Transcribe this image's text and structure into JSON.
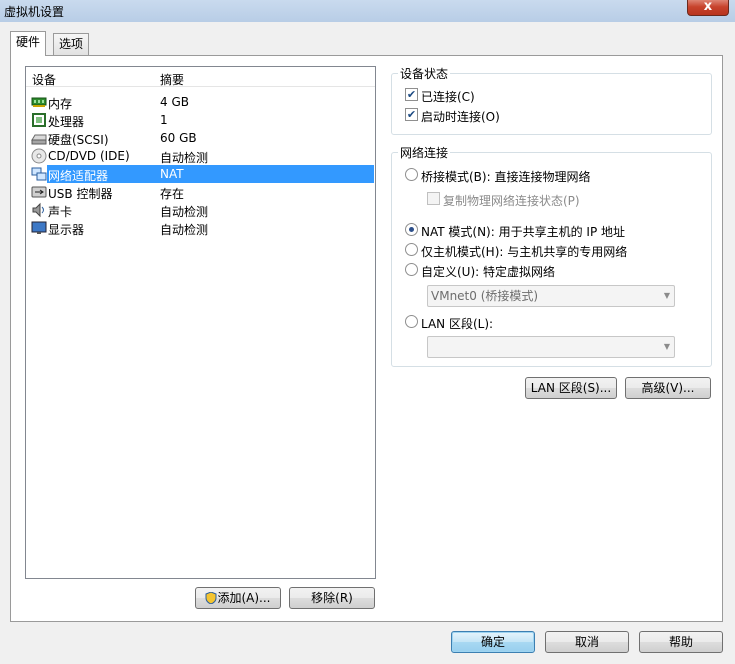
{
  "window": {
    "title": "虚拟机设置",
    "close_label": "x"
  },
  "tabs": [
    {
      "label": "硬件",
      "active": true
    },
    {
      "label": "选项",
      "active": false
    }
  ],
  "device_list": {
    "col_device": "设备",
    "col_summary": "摘要",
    "items": [
      {
        "name": "内存",
        "summary": "4 GB",
        "icon": "memory-icon"
      },
      {
        "name": "处理器",
        "summary": "1",
        "icon": "processor-icon"
      },
      {
        "name": "硬盘(SCSI)",
        "summary": "60 GB",
        "icon": "harddisk-icon"
      },
      {
        "name": "CD/DVD (IDE)",
        "summary": "自动检测",
        "icon": "cd-dvd-icon"
      },
      {
        "name": "网络适配器",
        "summary": "NAT",
        "icon": "network-adapter-icon",
        "selected": true
      },
      {
        "name": "USB 控制器",
        "summary": "存在",
        "icon": "usb-icon"
      },
      {
        "name": "声卡",
        "summary": "自动检测",
        "icon": "sound-card-icon"
      },
      {
        "name": "显示器",
        "summary": "自动检测",
        "icon": "display-icon"
      }
    ]
  },
  "buttons": {
    "add": "添加(A)...",
    "remove": "移除(R)",
    "lan_segment": "LAN 区段(S)...",
    "advanced": "高级(V)...",
    "ok": "确定",
    "cancel": "取消",
    "help": "帮助"
  },
  "device_status": {
    "title": "设备状态",
    "connected": {
      "label": "已连接(C)",
      "checked": true
    },
    "connect_at_power_on": {
      "label": "启动时连接(O)",
      "checked": true
    }
  },
  "network_connection": {
    "title": "网络连接",
    "bridged": {
      "label": "桥接模式(B): 直接连接物理网络",
      "checked": false
    },
    "replicate": {
      "label": "复制物理网络连接状态(P)",
      "checked": false
    },
    "nat": {
      "label": "NAT 模式(N): 用于共享主机的 IP 地址",
      "checked": true
    },
    "host_only": {
      "label": "仅主机模式(H): 与主机共享的专用网络",
      "checked": false
    },
    "custom": {
      "label": "自定义(U): 特定虚拟网络",
      "checked": false
    },
    "custom_select": "VMnet0 (桥接模式)",
    "lan": {
      "label": "LAN 区段(L):",
      "checked": false
    },
    "lan_select": ""
  },
  "colors": {
    "selection": "#3399ff",
    "titlebar": "#c9daee"
  }
}
